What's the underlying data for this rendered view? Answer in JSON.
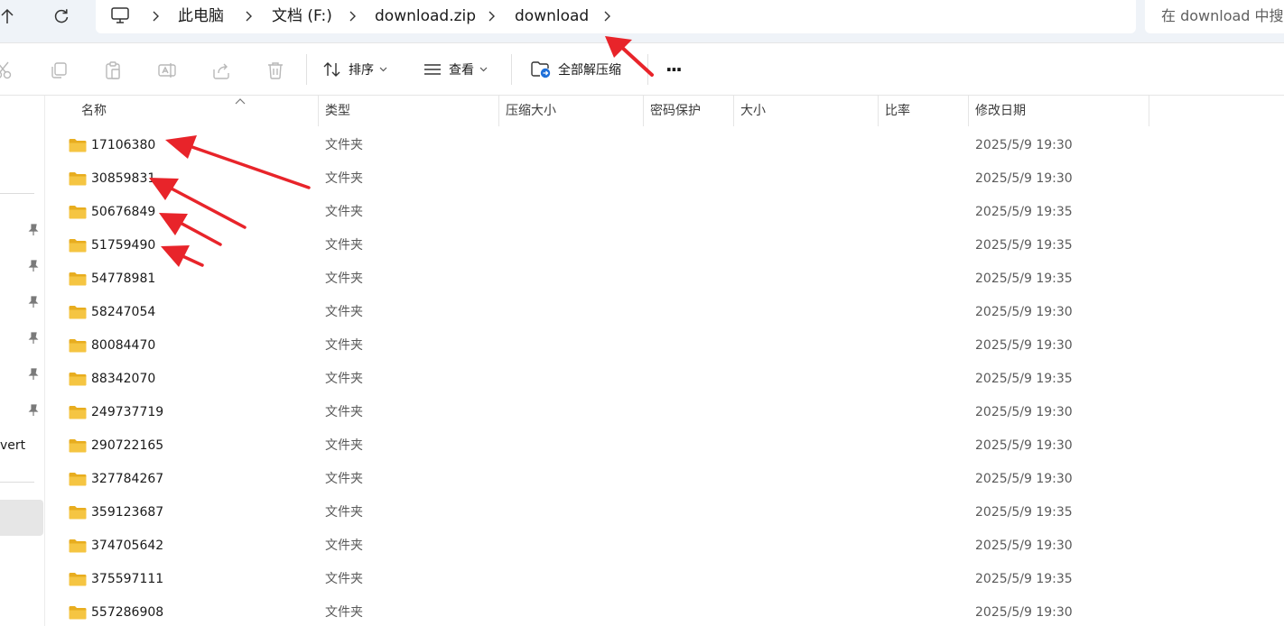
{
  "address_bar": {
    "breadcrumbs": [
      "此电脑",
      "文档 (F:)",
      "download.zip",
      "download"
    ],
    "search_placeholder": "在 download 中搜"
  },
  "toolbar": {
    "sort_label": "排序",
    "view_label": "查看",
    "extract_all_label": "全部解压缩",
    "more_label": "···"
  },
  "nav_pane": {
    "partial_label": "vert"
  },
  "columns": [
    "名称",
    "类型",
    "压缩大小",
    "密码保护",
    "大小",
    "比率",
    "修改日期"
  ],
  "files": [
    {
      "name": "17106380",
      "type": "文件夹",
      "modified": "2025/5/9 19:30"
    },
    {
      "name": "30859831",
      "type": "文件夹",
      "modified": "2025/5/9 19:30"
    },
    {
      "name": "50676849",
      "type": "文件夹",
      "modified": "2025/5/9 19:35"
    },
    {
      "name": "51759490",
      "type": "文件夹",
      "modified": "2025/5/9 19:35"
    },
    {
      "name": "54778981",
      "type": "文件夹",
      "modified": "2025/5/9 19:35"
    },
    {
      "name": "58247054",
      "type": "文件夹",
      "modified": "2025/5/9 19:30"
    },
    {
      "name": "80084470",
      "type": "文件夹",
      "modified": "2025/5/9 19:30"
    },
    {
      "name": "88342070",
      "type": "文件夹",
      "modified": "2025/5/9 19:35"
    },
    {
      "name": "249737719",
      "type": "文件夹",
      "modified": "2025/5/9 19:30"
    },
    {
      "name": "290722165",
      "type": "文件夹",
      "modified": "2025/5/9 19:30"
    },
    {
      "name": "327784267",
      "type": "文件夹",
      "modified": "2025/5/9 19:30"
    },
    {
      "name": "359123687",
      "type": "文件夹",
      "modified": "2025/5/9 19:35"
    },
    {
      "name": "374705642",
      "type": "文件夹",
      "modified": "2025/5/9 19:30"
    },
    {
      "name": "375597111",
      "type": "文件夹",
      "modified": "2025/5/9 19:35"
    },
    {
      "name": "557286908",
      "type": "文件夹",
      "modified": "2025/5/9 19:30"
    }
  ],
  "colors": {
    "folder": "#f5c542",
    "annotation_arrow": "#e8242a",
    "address_strip": "#eff3f8"
  }
}
